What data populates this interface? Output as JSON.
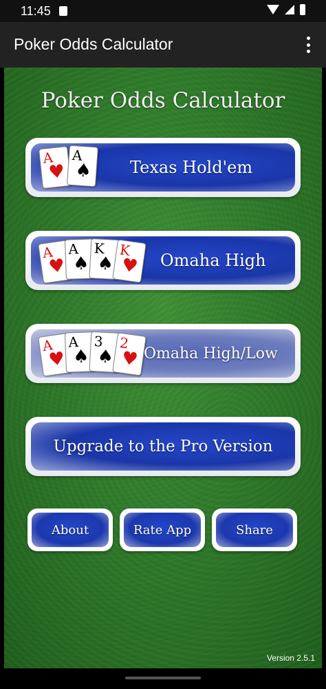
{
  "status": {
    "time": "11:45"
  },
  "appbar": {
    "title": "Poker Odds Calculator"
  },
  "main": {
    "headline": "Poker Odds Calculator",
    "games": [
      {
        "label": "Texas Hold'em",
        "cards": [
          {
            "rank": "A",
            "suit": "♥",
            "color": "red"
          },
          {
            "rank": "A",
            "suit": "♠",
            "color": "black"
          }
        ]
      },
      {
        "label": "Omaha High",
        "cards": [
          {
            "rank": "A",
            "suit": "♥",
            "color": "red"
          },
          {
            "rank": "A",
            "suit": "♠",
            "color": "black"
          },
          {
            "rank": "K",
            "suit": "♠",
            "color": "black"
          },
          {
            "rank": "K",
            "suit": "♥",
            "color": "red"
          }
        ]
      },
      {
        "label": "Omaha High/Low",
        "cards": [
          {
            "rank": "A",
            "suit": "♥",
            "color": "red"
          },
          {
            "rank": "A",
            "suit": "♠",
            "color": "black"
          },
          {
            "rank": "3",
            "suit": "♠",
            "color": "black"
          },
          {
            "rank": "2",
            "suit": "♥",
            "color": "red"
          }
        ]
      }
    ],
    "upgrade_label": "Upgrade to the Pro Version",
    "bottom_buttons": {
      "about": "About",
      "rate": "Rate App",
      "share": "Share"
    },
    "version": "Version 2.5.1"
  }
}
